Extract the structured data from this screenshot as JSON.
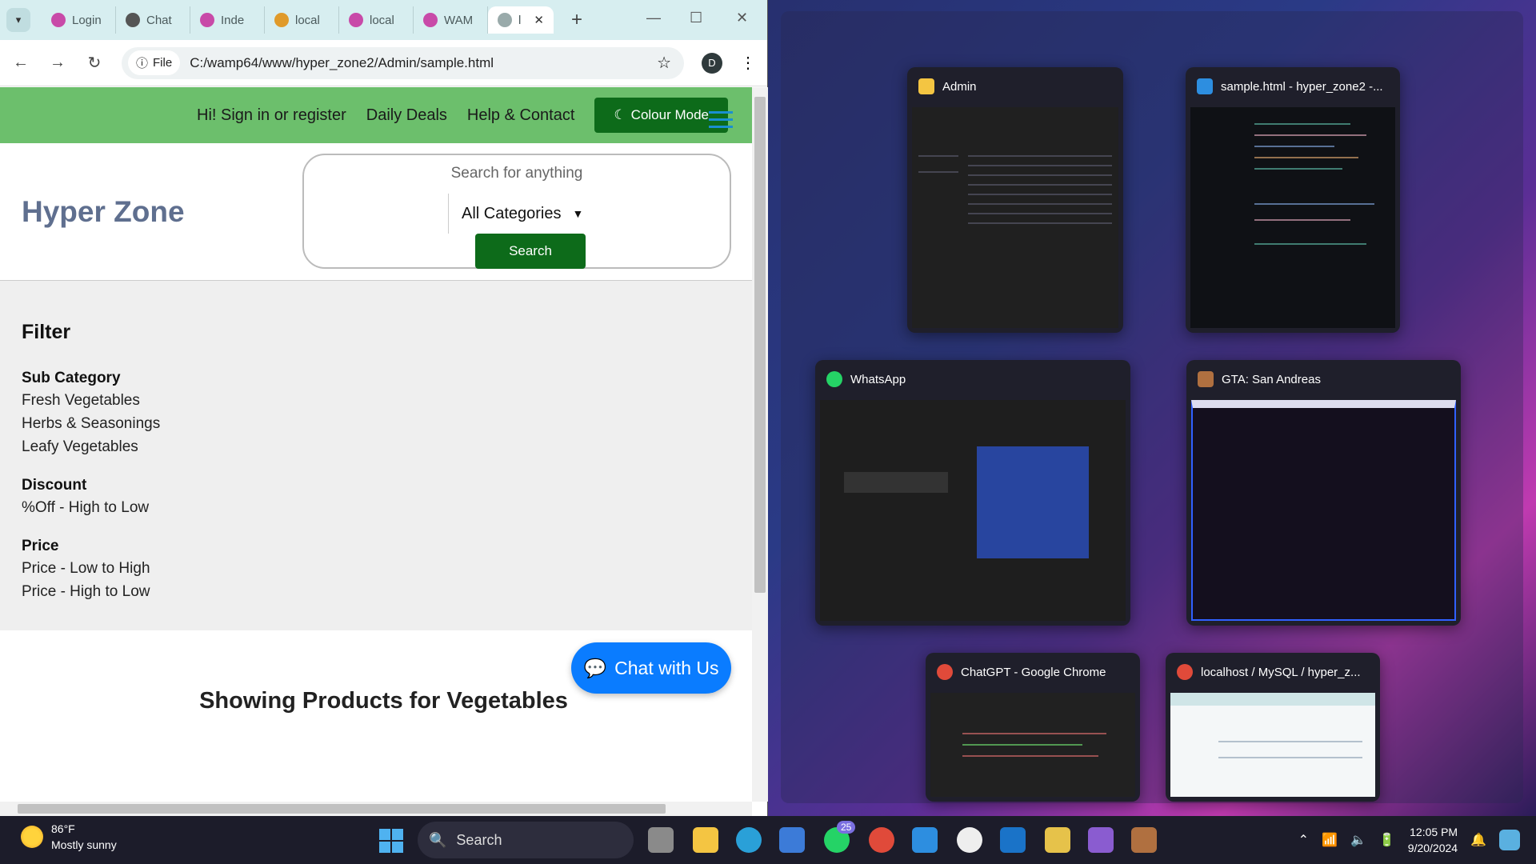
{
  "browser": {
    "tabs": [
      {
        "label": "Login",
        "color": "#c84aa8"
      },
      {
        "label": "Chat",
        "color": "#555"
      },
      {
        "label": "Inde",
        "color": "#c84aa8"
      },
      {
        "label": "local",
        "color": "#e09a2a"
      },
      {
        "label": "local",
        "color": "#c84aa8"
      },
      {
        "label": "WAM",
        "color": "#c84aa8"
      },
      {
        "label": "l",
        "color": "#9aa"
      }
    ],
    "chip_label": "File",
    "url": "C:/wamp64/www/hyper_zone2/Admin/sample.html",
    "profile_initial": "D"
  },
  "page": {
    "nav": {
      "signin": "Hi! Sign in or register",
      "deals": "Daily Deals",
      "help": "Help & Contact",
      "colour_mode": "Colour Mode"
    },
    "logo": "Hyper Zone",
    "search": {
      "placeholder": "Search for anything",
      "category": "All Categories",
      "button": "Search"
    },
    "filter": {
      "title": "Filter",
      "sub_category": {
        "heading": "Sub Category",
        "items": [
          "Fresh Vegetables",
          "Herbs & Seasonings",
          "Leafy Vegetables"
        ]
      },
      "discount": {
        "heading": "Discount",
        "items": [
          "%Off - High to Low"
        ]
      },
      "price": {
        "heading": "Price",
        "items": [
          "Price - Low to High",
          "Price - High to Low"
        ]
      }
    },
    "showing": "Showing Products for Vegetables",
    "chat_button": "Chat with Us"
  },
  "snap": {
    "windows": [
      {
        "title": "Admin",
        "icon_color": "#f4c542"
      },
      {
        "title": "sample.html - hyper_zone2 -...",
        "icon_color": "#2d8ee0"
      },
      {
        "title": "WhatsApp",
        "icon_color": "#25d366"
      },
      {
        "title": "GTA: San Andreas",
        "icon_color": "#b07040"
      },
      {
        "title": "ChatGPT - Google Chrome",
        "icon_color": "#e04a3a"
      },
      {
        "title": "localhost / MySQL / hyper_z...",
        "icon_color": "#e04a3a"
      }
    ]
  },
  "taskbar": {
    "temperature": "86°F",
    "condition": "Mostly sunny",
    "search": "Search",
    "whatsapp_badge": "25",
    "time": "12:05 PM",
    "date": "9/20/2024"
  }
}
